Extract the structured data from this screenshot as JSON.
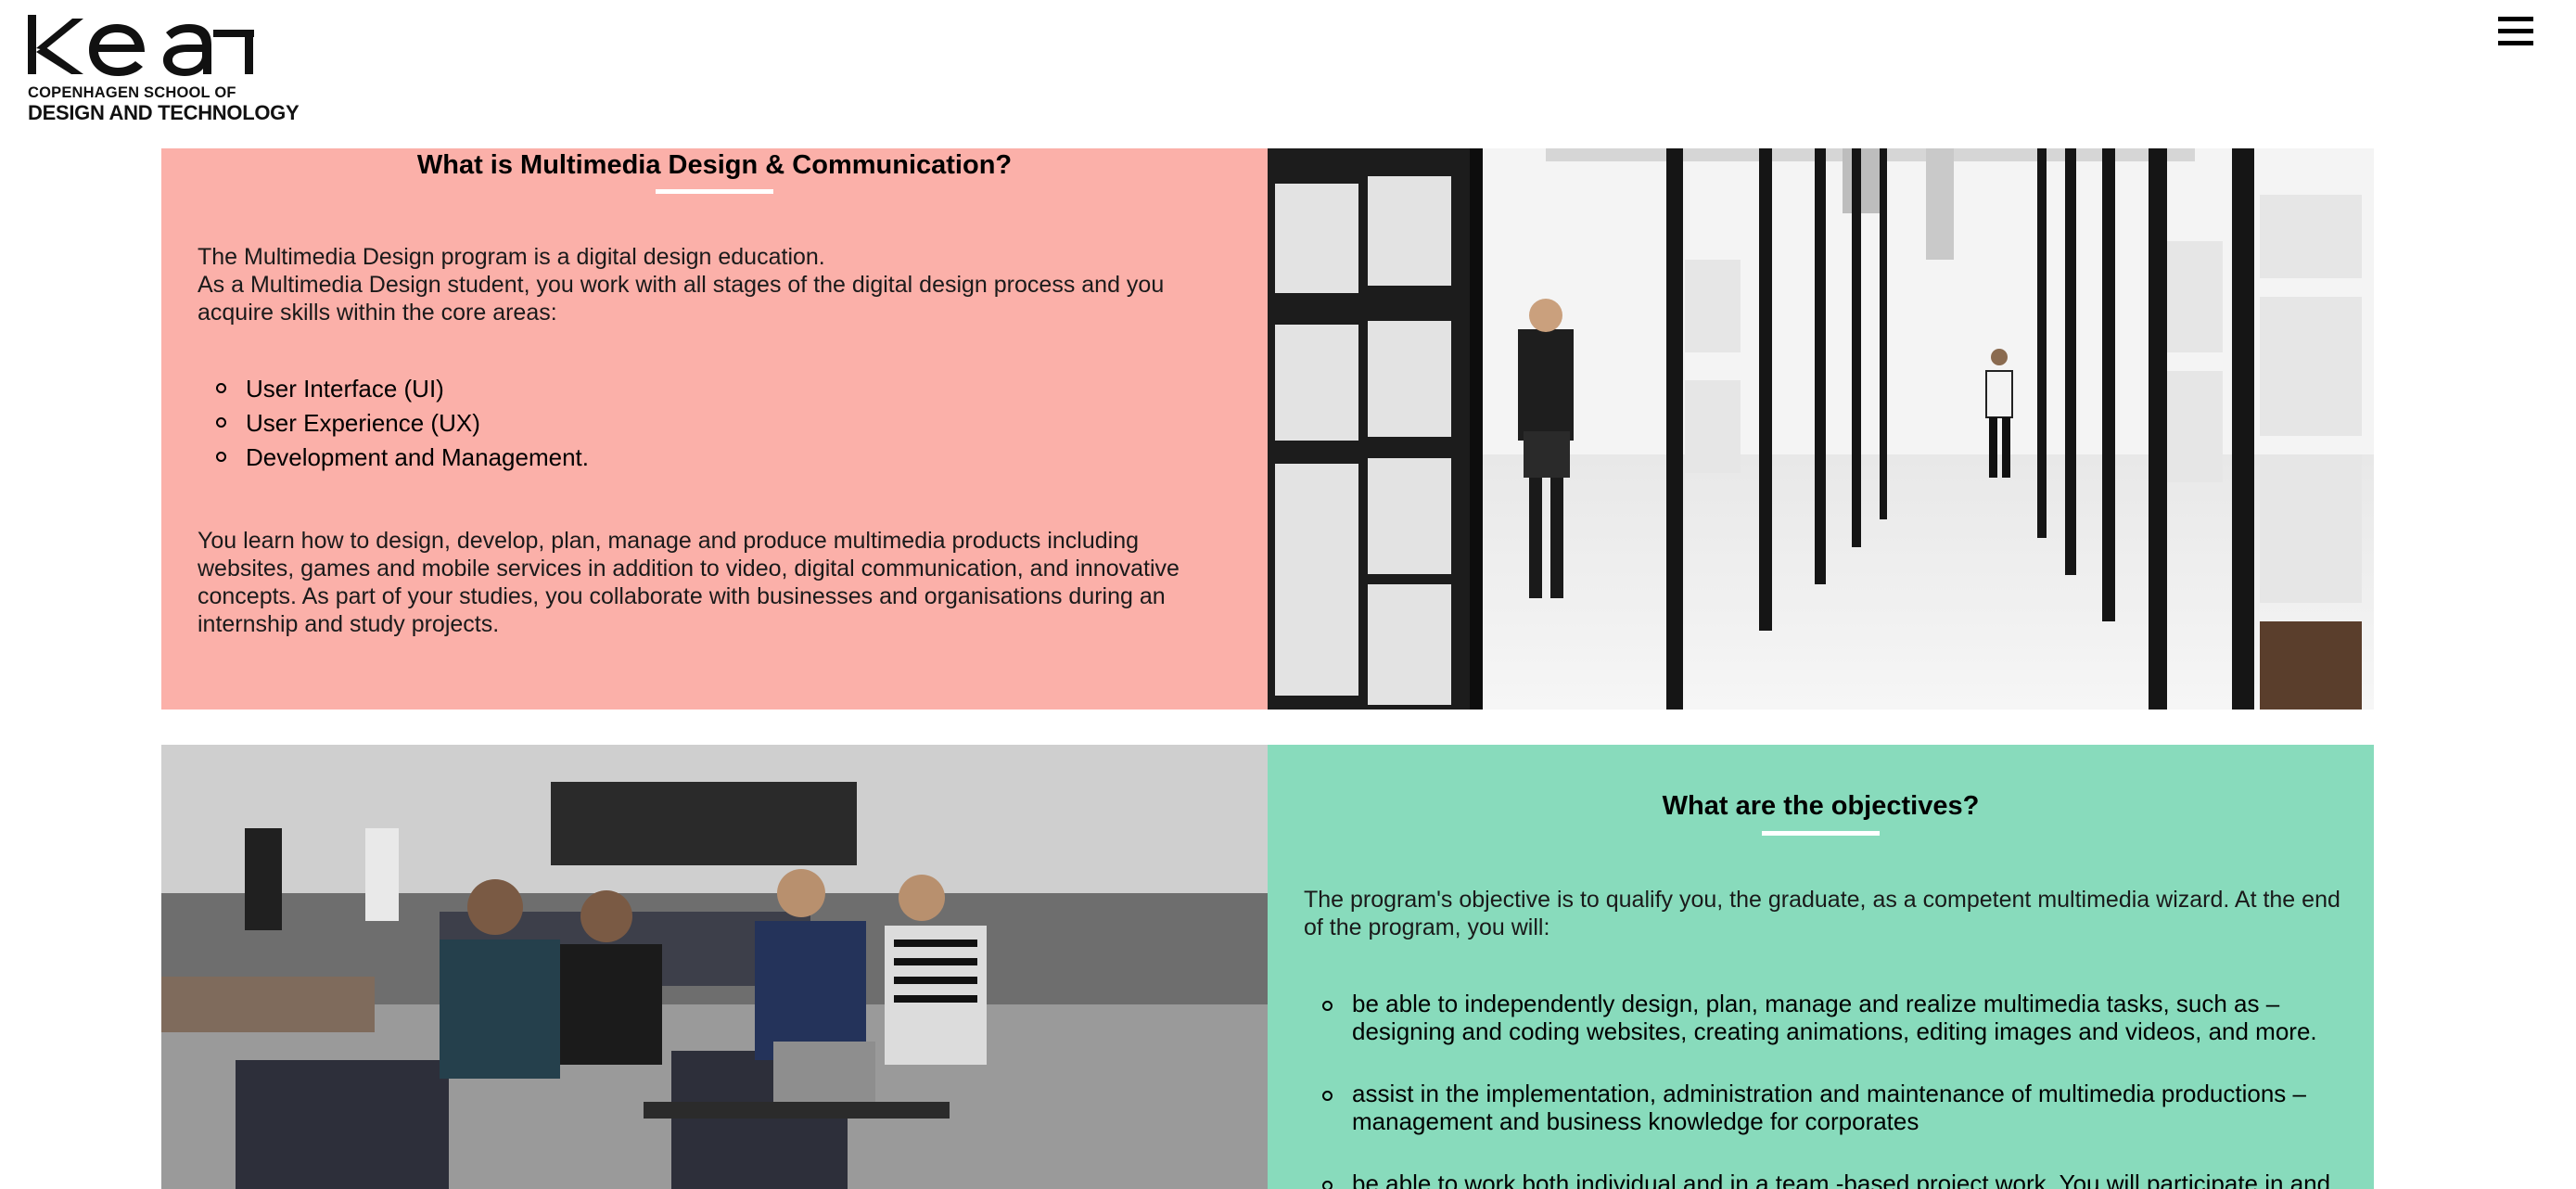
{
  "header": {
    "logo_text": "kea",
    "logo_line1": "COPENHAGEN SCHOOL OF",
    "logo_line2": "DESIGN AND TECHNOLOGY",
    "menu_icon": "hamburger-icon"
  },
  "section1": {
    "title": "What is Multimedia Design & Communication?",
    "intro": "The Multimedia Design program is a digital design education.\nAs a Multimedia Design student, you work with all stages of the digital design process and you acquire skills within the core areas:",
    "list": [
      "User Interface (UI)",
      "User Experience (UX)",
      "Development and Management."
    ],
    "body": "You learn how to design, develop, plan, manage and produce multimedia products including websites, games and mobile services in addition to video, digital communication, and innovative concepts. As part of your studies, you collaborate with businesses and organisations during an internship and study projects."
  },
  "section2": {
    "title": "What are the objectives?",
    "intro": "The program's objective is to qualify you, the graduate, as a competent multimedia wizard. At the end of the program, you will:",
    "list": [
      "be able to independently design, plan, manage and realize multimedia tasks, such as – designing and coding websites, creating animations, editing images and videos, and more.",
      "assist in the implementation, administration and maintenance of multimedia productions – management and business knowledge for corporates",
      "be able to work both individual and  in a team -based project work. You will participate in and"
    ]
  },
  "colors": {
    "section1_bg": "#fbb0a9",
    "section2_bg": "#88dbbc",
    "underline": "#ffffff"
  }
}
